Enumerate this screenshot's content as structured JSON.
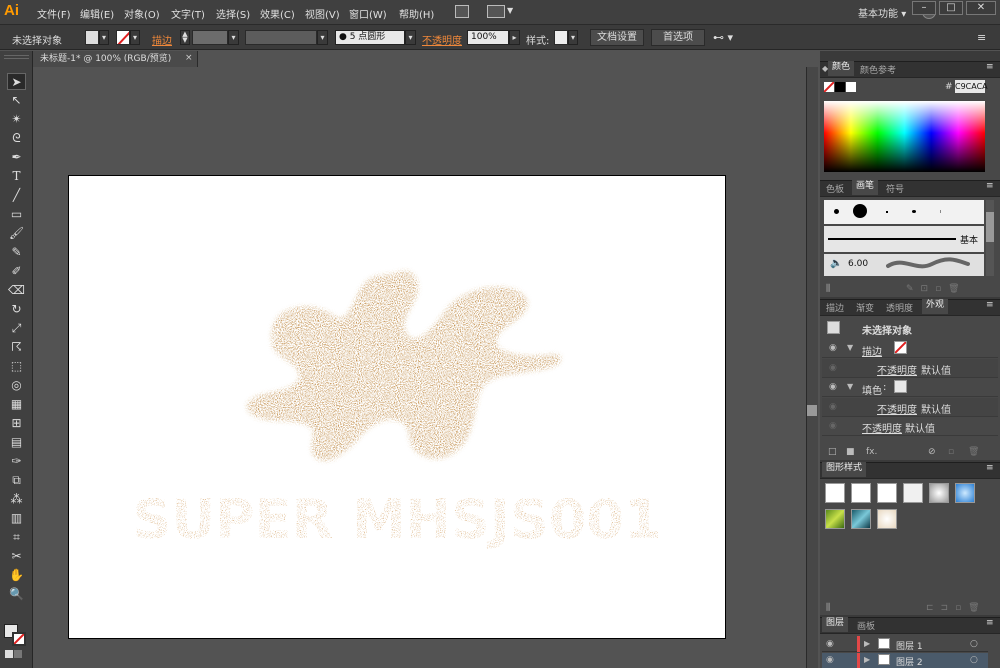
{
  "app": {
    "logo": "Ai",
    "workspace": "基本功能"
  },
  "menu": [
    "文件(F)",
    "编辑(E)",
    "对象(O)",
    "文字(T)",
    "选择(S)",
    "效果(C)",
    "视图(V)",
    "窗口(W)",
    "帮助(H)"
  ],
  "control": {
    "selection": "未选择对象",
    "stroke_label": "描边",
    "brush_value": "● 5 点圆形",
    "opacity_label": "不透明度",
    "opacity_value": "100%",
    "style_label": "样式:",
    "doc_setup": "文档设置",
    "preferences": "首选项"
  },
  "document": {
    "tab_title": "未标题-1* @ 100% (RGB/预览)"
  },
  "artwork": {
    "text": "SUPER MHSJS001"
  },
  "color_panel": {
    "tabs": [
      "颜色",
      "颜色参考"
    ],
    "hex_label": "#",
    "hex_value": "C9CACA"
  },
  "brush_panel": {
    "tabs": [
      "色板",
      "画笔",
      "符号"
    ],
    "basic_label": "基本",
    "stroke_size": "6.00"
  },
  "appearance_panel": {
    "tabs": [
      "描边",
      "渐变",
      "透明度",
      "外观"
    ],
    "title": "未选择对象",
    "rows": [
      {
        "label": "描边",
        "kind": "stroke"
      },
      {
        "label": "不透明度",
        "value": "默认值",
        "kind": "sub"
      },
      {
        "label": "填色",
        "kind": "fill"
      },
      {
        "label": "不透明度",
        "value": "默认值",
        "kind": "sub"
      },
      {
        "label": "不透明度",
        "value": "默认值",
        "kind": "top"
      }
    ]
  },
  "graphic_styles_panel": {
    "tabs": [
      "图形样式"
    ]
  },
  "layers_panel": {
    "tabs": [
      "图层",
      "画板"
    ],
    "layers": [
      "图层 1",
      "图层 2"
    ]
  },
  "colors": {
    "accent_orange": "#f0883a",
    "art_brown": "#b87a2c"
  }
}
